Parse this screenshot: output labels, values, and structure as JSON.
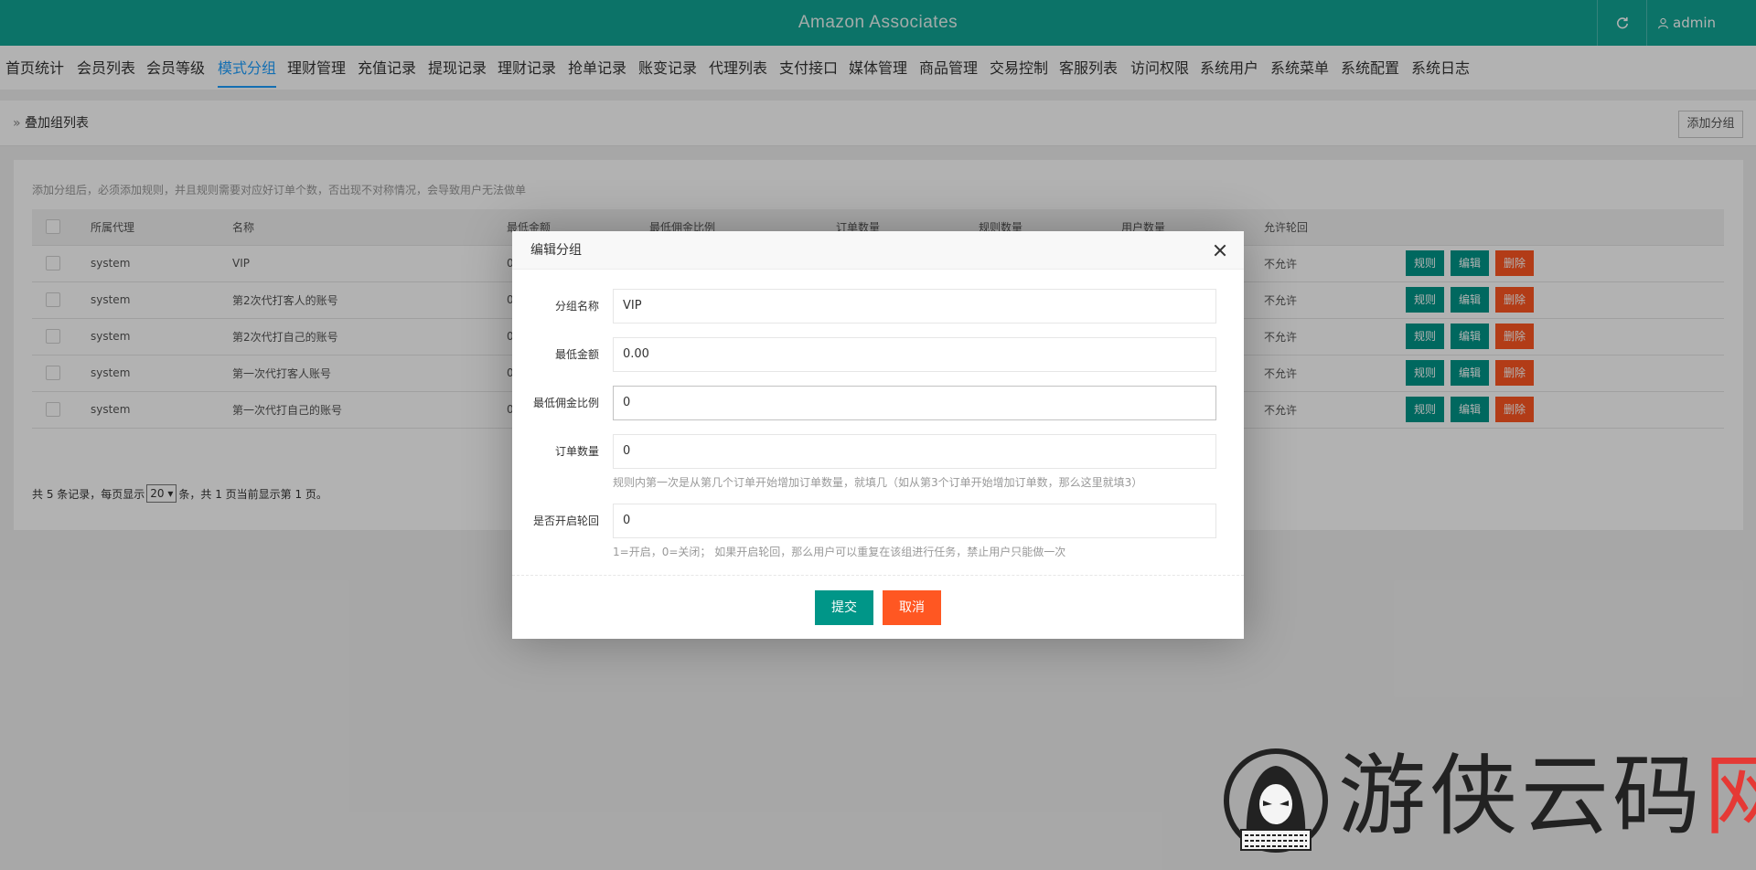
{
  "app": {
    "title": "Amazon Associates",
    "user": "admin",
    "refresh_icon": "refresh-icon",
    "user_icon": "user-icon"
  },
  "nav": [
    {
      "label": "首页统计"
    },
    {
      "label": "会员列表"
    },
    {
      "label": "会员等级"
    },
    {
      "label": "模式分组",
      "active": true
    },
    {
      "label": "理财管理"
    },
    {
      "label": "充值记录"
    },
    {
      "label": "提现记录"
    },
    {
      "label": "理财记录"
    },
    {
      "label": "抢单记录"
    },
    {
      "label": "账变记录"
    },
    {
      "label": "代理列表"
    },
    {
      "label": "支付接口"
    },
    {
      "label": "媒体管理"
    },
    {
      "label": "商品管理"
    },
    {
      "label": "交易控制"
    },
    {
      "label": "客服列表"
    },
    {
      "label": "访问权限"
    },
    {
      "label": "系统用户"
    },
    {
      "label": "系统菜单"
    },
    {
      "label": "系统配置"
    },
    {
      "label": "系统日志"
    }
  ],
  "breadcrumb": "叠加组列表",
  "add_group_label": "添加分组",
  "hint": "添加分组后，必须添加规则，并且规则需要对应好订单个数，否出现不对称情况，会导致用户无法做单",
  "table": {
    "headers": [
      "所属代理",
      "名称",
      "最低金额",
      "最低佣金比例",
      "订单数量",
      "规则数量",
      "用户数量",
      "允许轮回"
    ],
    "rows": [
      {
        "agent": "system",
        "name": "VIP",
        "min_amount": "0",
        "allow": "不允许"
      },
      {
        "agent": "system",
        "name": "第2次代打客人的账号",
        "min_amount": "0",
        "allow": "不允许"
      },
      {
        "agent": "system",
        "name": "第2次代打自己的账号",
        "min_amount": "0",
        "allow": "不允许"
      },
      {
        "agent": "system",
        "name": "第一次代打客人账号",
        "min_amount": "0",
        "allow": "不允许"
      },
      {
        "agent": "system",
        "name": "第一次代打自己的账号",
        "min_amount": "0",
        "allow": "不允许"
      }
    ],
    "actions": {
      "rule": "规则",
      "edit": "编辑",
      "delete": "删除"
    }
  },
  "pager": {
    "prefix": "共 5 条记录，每页显示",
    "page_size": "20",
    "suffix": "条，共 1 页当前显示第 1 页。"
  },
  "dialog": {
    "title": "编辑分组",
    "fields": [
      {
        "label": "分组名称",
        "value": "VIP"
      },
      {
        "label": "最低金额",
        "value": "0.00"
      },
      {
        "label": "最低佣金比例",
        "value": "0"
      },
      {
        "label": "订单数量",
        "value": "0",
        "help": "规则内第一次是从第几个订单开始增加订单数量，就填几（如从第3个订单开始增加订单数，那么这里就填3）"
      },
      {
        "label": "是否开启轮回",
        "value": "0",
        "help": "1=开启，0=关闭； 如果开启轮回，那么用户可以重复在该组进行任务，禁止用户只能做一次"
      }
    ],
    "submit": "提交",
    "cancel": "取消"
  },
  "watermark": {
    "text": "游侠云码",
    "accent": "网"
  },
  "colors": {
    "header": "#12a596",
    "accent_blue": "#1e9fff",
    "green": "#009688",
    "red": "#ff5722"
  }
}
